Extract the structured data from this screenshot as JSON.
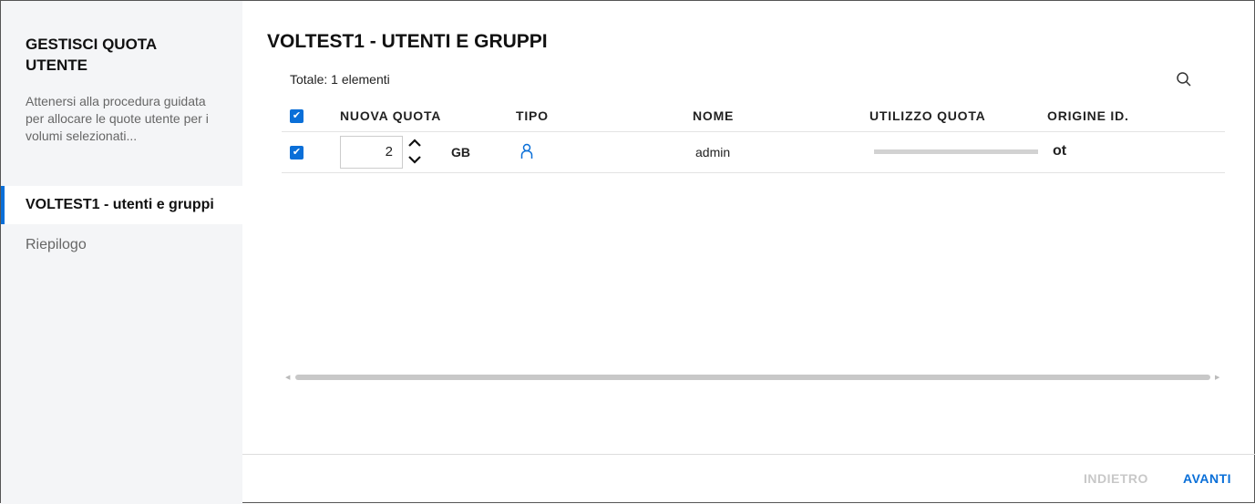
{
  "sidebar": {
    "title": "GESTISCI QUOTA UTENTE",
    "description": "Attenersi alla procedura guidata per allocare le quote utente per i volumi selezionati...",
    "steps": [
      {
        "label": "VOLTEST1 - utenti e gruppi"
      },
      {
        "label": "Riepilogo"
      }
    ]
  },
  "main": {
    "title": "VOLTEST1 - UTENTI E GRUPPI",
    "total": "Totale: 1 elementi",
    "columns": [
      "NUOVA QUOTA",
      "TIPO",
      "NOME",
      "UTILIZZO QUOTA",
      "ORIGINE ID."
    ],
    "rows": [
      {
        "quota": "2",
        "unit": "GB",
        "type": "user-icon",
        "name": "admin",
        "usage_percent": 0,
        "origin": "ot"
      }
    ]
  },
  "footer": {
    "back": "INDIETRO",
    "next": "AVANTI"
  },
  "colors": {
    "accent": "#0a6fd8"
  }
}
